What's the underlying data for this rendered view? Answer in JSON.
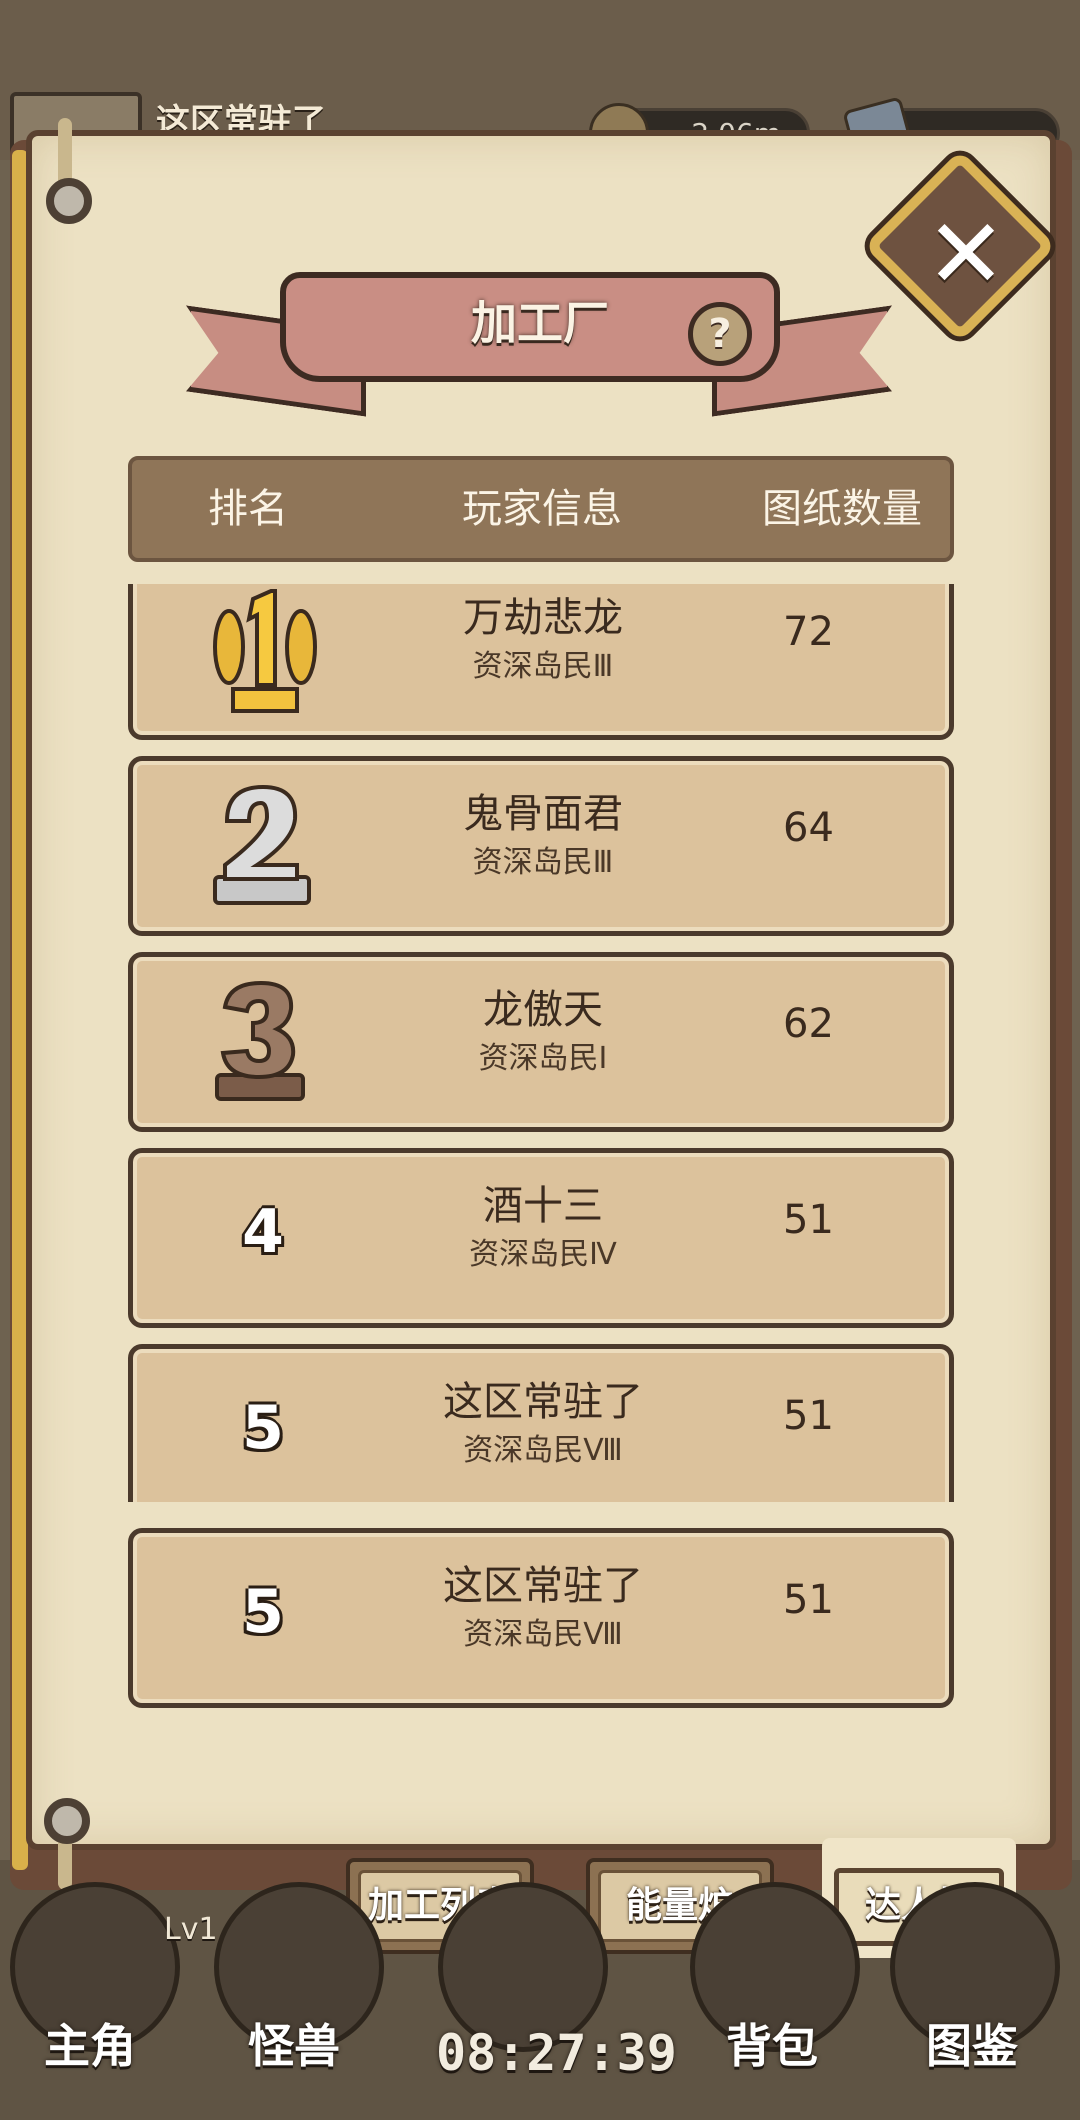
{
  "top_bar": {
    "player_name": "这区常驻了",
    "resource_1_value": "2.06m",
    "resource_2_value": ""
  },
  "panel": {
    "title": "加工厂",
    "close_glyph": "✕",
    "help_glyph": "?"
  },
  "table": {
    "headers": {
      "rank": "排名",
      "player_info": "玩家信息",
      "blueprint_count": "图纸数量"
    },
    "rows": [
      {
        "rank": "1",
        "name": "万劫悲龙",
        "title": "资深岛民Ⅲ",
        "count": "72"
      },
      {
        "rank": "2",
        "name": "鬼骨面君",
        "title": "资深岛民Ⅲ",
        "count": "64"
      },
      {
        "rank": "3",
        "name": "龙傲天",
        "title": "资深岛民Ⅰ",
        "count": "62"
      },
      {
        "rank": "4",
        "name": "酒十三",
        "title": "资深岛民Ⅳ",
        "count": "51"
      },
      {
        "rank": "5",
        "name": "这区常驻了",
        "title": "资深岛民Ⅷ",
        "count": "51"
      }
    ],
    "my_row": {
      "rank": "5",
      "name": "这区常驻了",
      "title": "资深岛民Ⅷ",
      "count": "51"
    }
  },
  "tabs": {
    "process_list": "加工列表",
    "energy_furnace": "能量炉",
    "leaderboard": "达人榜"
  },
  "bottom_nav": {
    "hero": "主角",
    "hero_level": "Lv1",
    "monster": "怪兽",
    "bag": "背包",
    "codex": "图鉴",
    "timer": "08:27:39"
  },
  "colors": {
    "parchment": "#ece1c3",
    "row_bg": "#dcc29c",
    "header_bg": "#8f7558",
    "ribbon": "#c98e84",
    "gold": "#d9b04a",
    "silver": "#c8c8c8",
    "bronze": "#8a6a55"
  },
  "icons": {
    "close": "close-icon",
    "help": "question-icon",
    "rank_1": "gold-laurel-medal-icon",
    "rank_2": "silver-medal-icon",
    "rank_3": "bronze-medal-icon"
  }
}
